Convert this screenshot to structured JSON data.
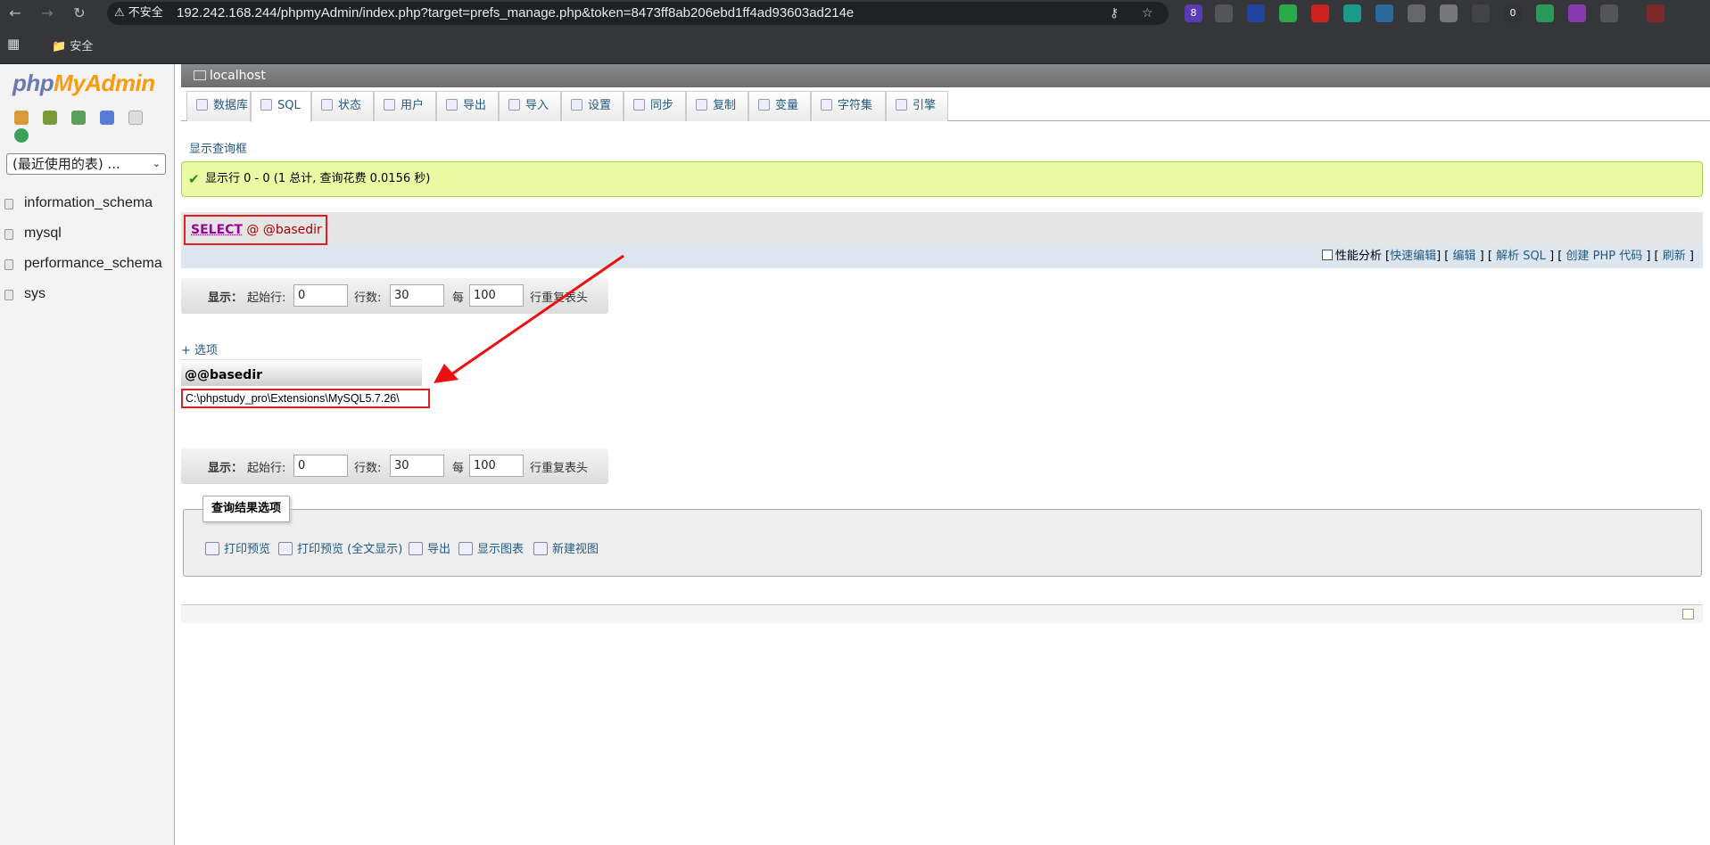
{
  "browser": {
    "security_label": "不安全",
    "url": "192.242.168.244/phpmyAdmin/index.php?target=prefs_manage.php&token=8473ff8ab206ebd1ff4ad93603ad214e",
    "bookmark_folder": "安全",
    "extension_badges": [
      "8",
      "0"
    ]
  },
  "sidebar": {
    "logo_php": "php",
    "logo_myadmin": "MyAdmin",
    "db_select": "(最近使用的表) ...",
    "databases": [
      "information_schema",
      "mysql",
      "performance_schema",
      "sys"
    ]
  },
  "server": {
    "name": "localhost"
  },
  "tabs": [
    "数据库",
    "SQL",
    "状态",
    "用户",
    "导出",
    "导入",
    "设置",
    "同步",
    "复制",
    "变量",
    "字符集",
    "引擎"
  ],
  "show_query_box": "显示查询框",
  "success_message": "显示行 0 - 0 (1 总计, 查询花费 0.0156 秒)",
  "sql": {
    "keyword": "SELECT",
    "rest": " @ @basedir"
  },
  "sql_options": {
    "profiling": "性能分析",
    "inline_edit": "快速编辑",
    "edit": "编辑",
    "explain": "解析 SQL",
    "php_code": "创建 PHP 代码",
    "refresh": "刷新"
  },
  "nav_table": {
    "show_label": "显示：",
    "start_label": "起始行:",
    "start_value": "0",
    "rows_label": "行数:",
    "rows_value": "30",
    "every_label": "每",
    "every_value": "100",
    "repeat_label": "行重复表头"
  },
  "options_link": "+ 选项",
  "result": {
    "column": "@@basedir",
    "value": "C:\\phpstudy_pro\\Extensions\\MySQL5.7.26\\"
  },
  "query_ops": {
    "legend": "查询结果选项",
    "items": [
      "打印预览",
      "打印预览 (全文显示)",
      "导出",
      "显示图表",
      "新建视图"
    ]
  },
  "colors": {
    "accent": "#235a81",
    "highlight": "#e02020",
    "success_bg": "#ebf8a4"
  }
}
